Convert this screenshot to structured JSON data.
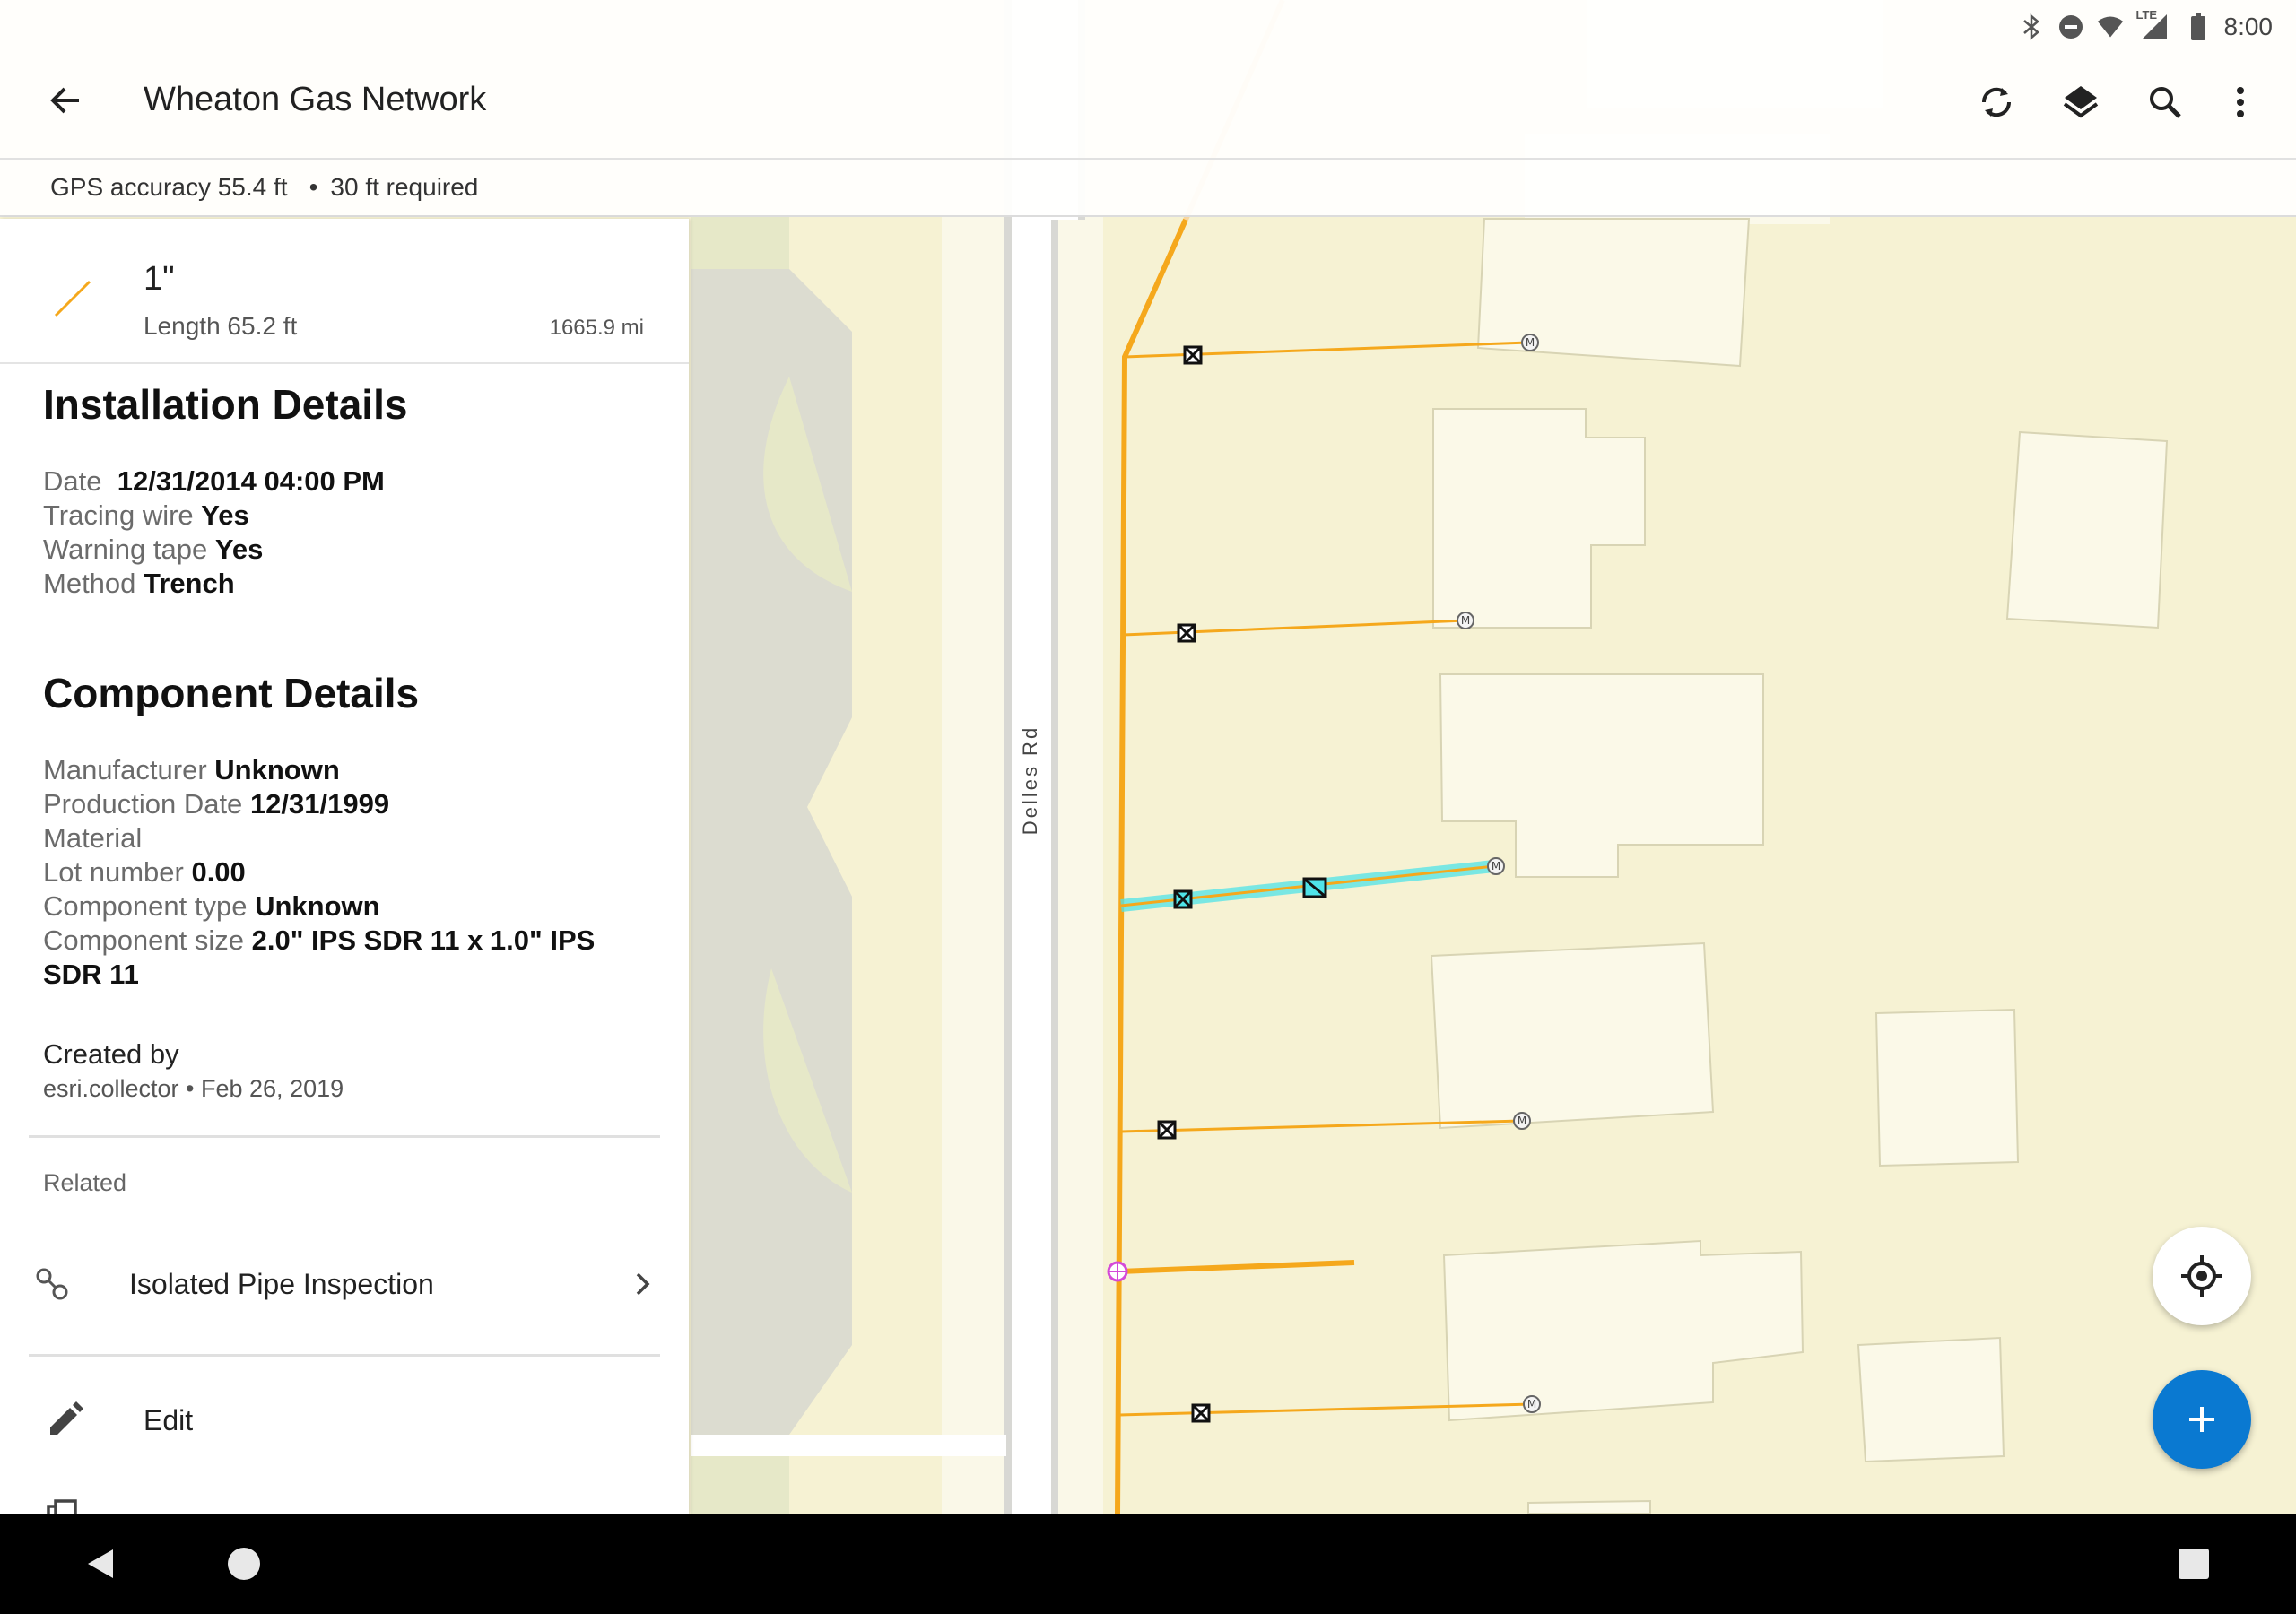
{
  "status_bar": {
    "time": "8:00",
    "network_label": "LTE",
    "icons": [
      "bluetooth-icon",
      "do-not-disturb-icon",
      "wifi-icon",
      "cellular-signal-icon",
      "battery-icon"
    ]
  },
  "app_bar": {
    "title": "Wheaton Gas Network",
    "actions": [
      "sync-icon",
      "layers-icon",
      "search-icon",
      "more-vert-icon"
    ]
  },
  "gps_bar": {
    "accuracy": "GPS accuracy 55.4 ft",
    "separator": "•",
    "required": "30 ft required"
  },
  "feature": {
    "title": "1\"",
    "length": "Length 65.2 ft",
    "distance": "1665.9 mi",
    "icon": "line-feature-icon",
    "icon_color": "#f5a81c"
  },
  "installation": {
    "title": "Installation Details",
    "fields": [
      {
        "label": "Date",
        "value": "12/31/2014 04:00 PM"
      },
      {
        "label": "Tracing wire",
        "value": "Yes"
      },
      {
        "label": "Warning tape",
        "value": "Yes"
      },
      {
        "label": "Method",
        "value": "Trench"
      }
    ]
  },
  "component": {
    "title": "Component Details",
    "fields": [
      {
        "label": "Manufacturer",
        "value": "Unknown"
      },
      {
        "label": "Production Date",
        "value": "12/31/1999"
      },
      {
        "label": "Material",
        "value": ""
      },
      {
        "label": "Lot number",
        "value": "0.00"
      },
      {
        "label": "Component type",
        "value": "Unknown"
      },
      {
        "label": "Component size",
        "value": "2.0\" IPS SDR 11 x 1.0\" IPS SDR 11"
      }
    ]
  },
  "created": {
    "label": "Created by",
    "info": "esri.collector • Feb 26, 2019"
  },
  "related": {
    "label": "Related",
    "item": "Isolated Pipe Inspection"
  },
  "actions": {
    "edit": "Edit"
  },
  "map": {
    "road_label": "Delles Rd",
    "main_color": "#f5a81c",
    "highlight_color": "#4fe3e8"
  },
  "nav_bar": {
    "icons": [
      "back-nav-icon",
      "home-nav-icon",
      "recents-nav-icon"
    ]
  }
}
